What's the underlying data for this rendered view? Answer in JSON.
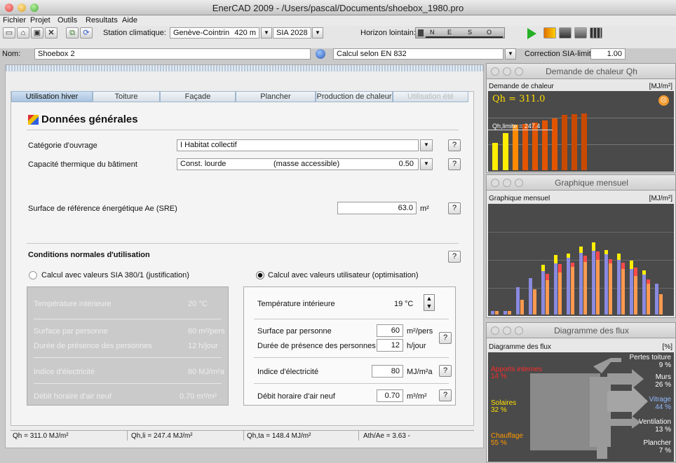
{
  "window": {
    "title": "EnerCAD 2009  -  /Users/pascal/Documents/shoebox_1980.pro"
  },
  "menu": [
    "Fichier",
    "Projet",
    "Outils",
    "Resultats",
    "Aide"
  ],
  "toolbar": {
    "station_label": "Station climatique:",
    "station_value": "Genève-Cointrin",
    "altitude": "420 m",
    "norm_value": "SIA 2028",
    "horizon_label": "Horizon lointain:",
    "horizon_letters": [
      "N",
      "E",
      "S",
      "O"
    ],
    "name_label": "Nom:",
    "name_value": "Shoebox 2",
    "calc_value": "Calcul selon EN 832",
    "correction_label": "Correction SIA-limite:",
    "correction_value": "1.00"
  },
  "tabs": [
    {
      "label": "Utilisation hiver",
      "state": "active"
    },
    {
      "label": "Toiture",
      "state": "normal"
    },
    {
      "label": "Façade",
      "state": "normal"
    },
    {
      "label": "Plancher",
      "state": "normal"
    },
    {
      "label": "Production de chaleur",
      "state": "normal"
    },
    {
      "label": "Utilisation été",
      "state": "disabled"
    }
  ],
  "section": {
    "title": "Données générales",
    "category_label": "Catégorie d'ouvrage",
    "category_value": "I      Habitat collectif",
    "capacity_label": "Capacité thermique du bâtiment",
    "capacity_value": "Const. lourde",
    "capacity_note": "(masse accessible)",
    "capacity_num": "0.50",
    "sre_label": "Surface de référence énergétique Ae (SRE)",
    "sre_value": "63.0",
    "sre_unit": "m²",
    "conditions_title": "Conditions normales d'utilisation",
    "radio_sia": "Calcul avec valeurs SIA 380/1 (justification)",
    "radio_user": "Calcul avec valeurs utilisateur (optimisation)",
    "help": "?"
  },
  "sia": {
    "temp_label": "Température intérieure",
    "temp_value": "20 °C",
    "surface_label": "Surface par personne",
    "surface_value": "60 m²/pers",
    "presence_label": "Durée de présence des personnes",
    "presence_value": "12 h/jour",
    "elec_label": "Indice d'électricité",
    "elec_value": "80 MJ/m²a",
    "air_label": "Débit horaire d'air neuf",
    "air_value": "0.70 m³/m²"
  },
  "user": {
    "temp_label": "Température intérieure",
    "temp_value": "19",
    "temp_unit": "°C",
    "surface_label": "Surface par personne",
    "surface_value": "60",
    "surface_unit": "m²/pers",
    "presence_label": "Durée de présence des personnes",
    "presence_value": "12",
    "presence_unit": "h/jour",
    "elec_label": "Indice d'électricité",
    "elec_value": "80",
    "elec_unit": "MJ/m²a",
    "air_label": "Débit horaire d'air neuf",
    "air_value": "0.70",
    "air_unit": "m³/m²"
  },
  "status": {
    "qh": "Qh = 311.0 MJ/m²",
    "qhli": "Qh,li = 247.4 MJ/m²",
    "qhta": "Qh,ta = 148.4 MJ/m²",
    "ath": "Ath/Ae = 3.63 -"
  },
  "demande": {
    "title": "Demande de chaleur Qh",
    "subtitle": "Demande de chaleur",
    "unit": "[MJ/m²]",
    "qh_text": "Qh = 311.0",
    "limit_text": "Qh,limite = 247.4"
  },
  "mensuel": {
    "title": "Graphique mensuel",
    "subtitle": "Graphique mensuel",
    "unit": "[MJ/m²]"
  },
  "flux": {
    "title": "Diagramme des flux",
    "subtitle": "Diagramme des flux",
    "unit": "[%]",
    "inputs": [
      {
        "name": "Apports internes",
        "value": "14 %",
        "color": "#ff2a2a"
      },
      {
        "name": "Solaires",
        "value": "32 %",
        "color": "#ffe000"
      },
      {
        "name": "Chauffage",
        "value": "55 %",
        "color": "#ff9900"
      }
    ],
    "outputs": [
      {
        "name": "Pertes toiture",
        "value": "9 %",
        "color": "#ffffff"
      },
      {
        "name": "Murs",
        "value": "26 %",
        "color": "#ffffff"
      },
      {
        "name": "Vitrage",
        "value": "44 %",
        "color": "#8fb8ff"
      },
      {
        "name": "Ventilation",
        "value": "13 %",
        "color": "#ffffff"
      },
      {
        "name": "Plancher",
        "value": "7 %",
        "color": "#ffffff"
      }
    ]
  },
  "colors": {
    "accent": "#ffdd00",
    "orange": "#e85a00",
    "blue": "#8080e0"
  }
}
